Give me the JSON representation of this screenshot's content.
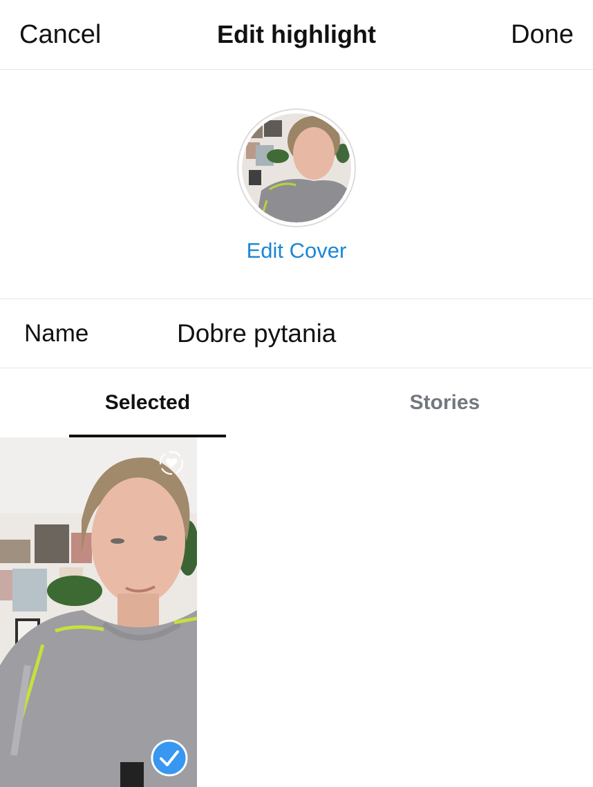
{
  "header": {
    "cancel_label": "Cancel",
    "title": "Edit highlight",
    "done_label": "Done"
  },
  "cover": {
    "edit_cover_label": "Edit Cover",
    "accent_color": "#1a86d6"
  },
  "name_field": {
    "label": "Name",
    "value": "Dobre pytania"
  },
  "tabs": [
    {
      "label": "Selected",
      "active": true
    },
    {
      "label": "Stories",
      "active": false
    }
  ],
  "grid": {
    "items": [
      {
        "selected": true,
        "icons": [
          "heart-badge-icon",
          "check-circle-icon"
        ]
      }
    ]
  }
}
